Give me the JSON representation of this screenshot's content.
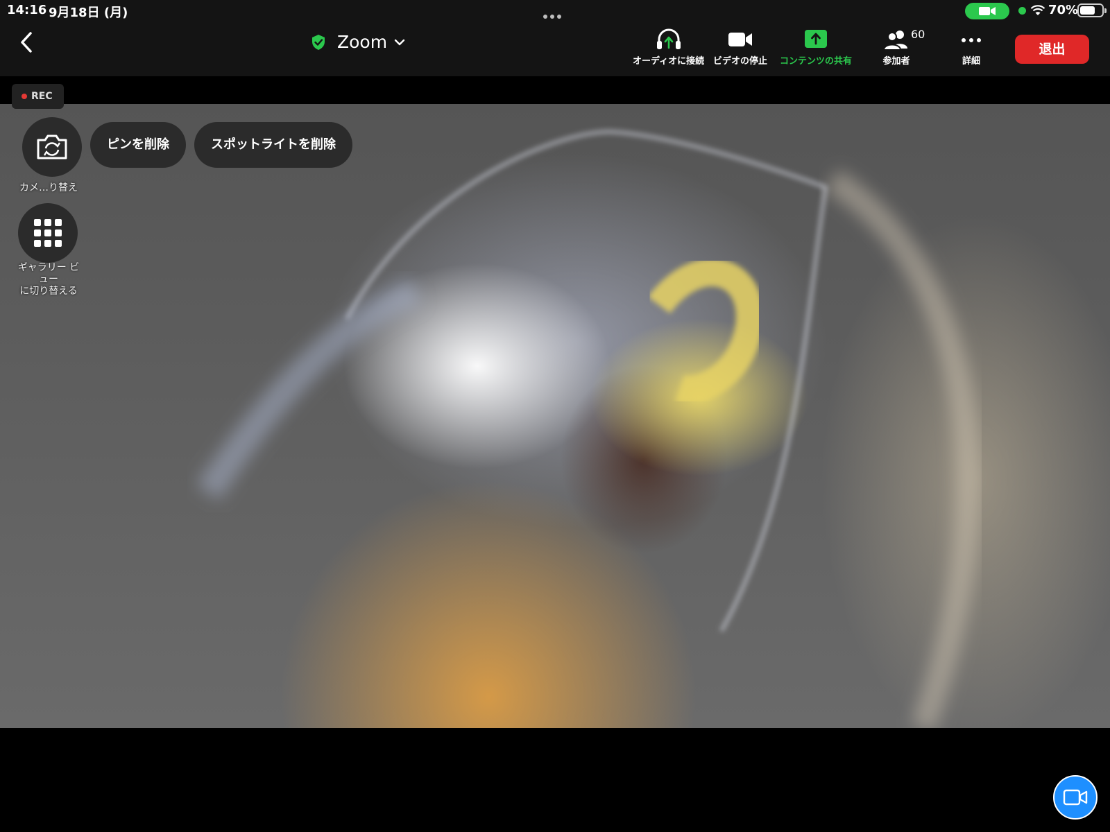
{
  "status_bar": {
    "time": "14:16",
    "date": "9月18日 (月)",
    "battery_percent": "70%",
    "battery_level": 0.7
  },
  "toolbar": {
    "title": "Zoom",
    "audio_label": "オーディオに接続",
    "video_label": "ビデオの停止",
    "share_label": "コンテンツの共有",
    "participants_label": "参加者",
    "participants_count": "60",
    "more_label": "詳細",
    "leave_label": "退出"
  },
  "video": {
    "rec_label": "REC",
    "switch_camera_label": "カメ…り替え",
    "unpin_label": "ピンを削除",
    "remove_spotlight_label": "スポットライトを削除",
    "gallery_label_line1": "ギャラリー ビ",
    "gallery_label_line2": "ュー",
    "gallery_label_line3": "に切り替える"
  },
  "colors": {
    "share_green": "#2bc84d",
    "leave_red": "#e02828",
    "video_blue": "#1e8fff"
  }
}
